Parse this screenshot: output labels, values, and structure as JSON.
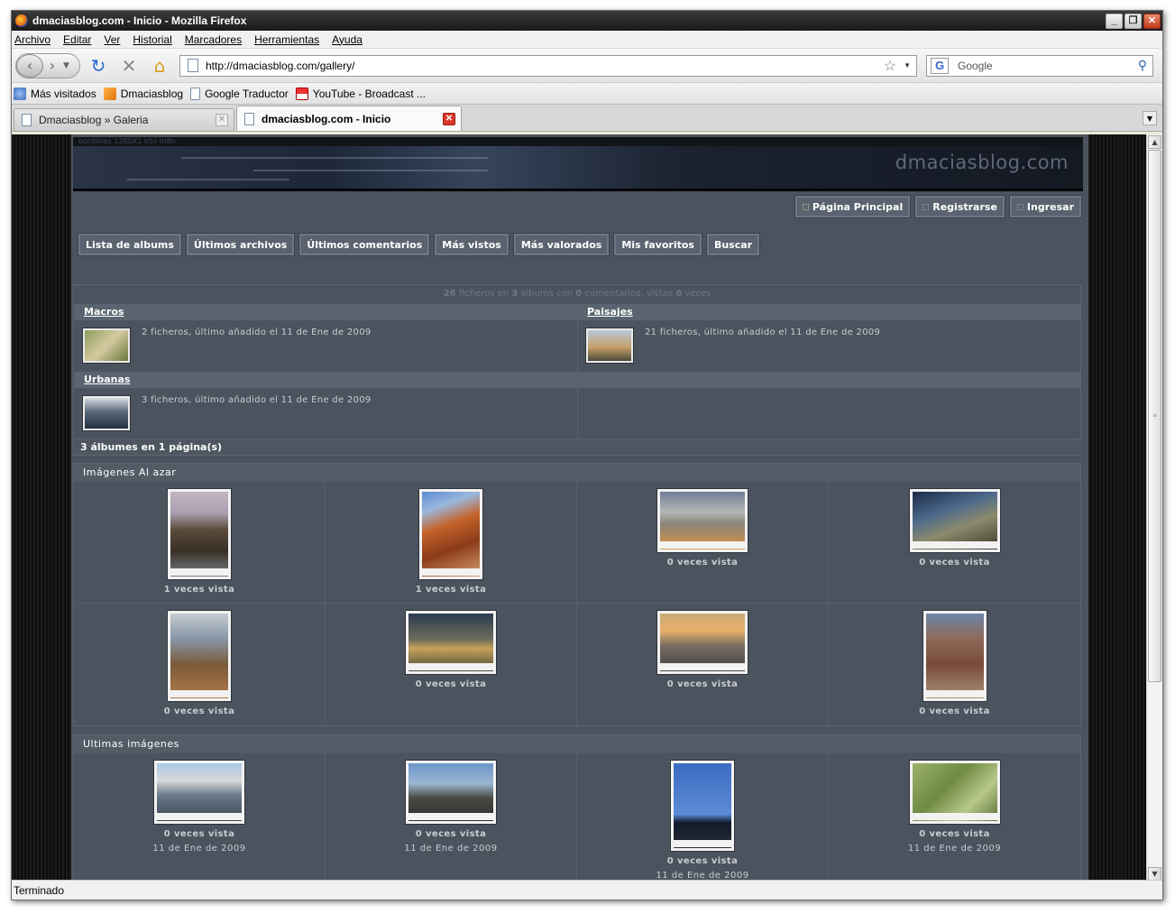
{
  "window": {
    "title": "dmaciasblog.com - Inicio - Mozilla Firefox"
  },
  "menubar": [
    "Archivo",
    "Editar",
    "Ver",
    "Historial",
    "Marcadores",
    "Herramientas",
    "Ayuda"
  ],
  "navbar": {
    "url": "http://dmaciasblog.com/gallery/",
    "search_placeholder": "Google"
  },
  "bookmarks": [
    "Más visitados",
    "Dmaciasblog",
    "Google Traductor",
    "YouTube - Broadcast ..."
  ],
  "tabs": [
    {
      "label": "Dmaciasblog » Galeria",
      "active": false
    },
    {
      "label": "dmaciasblog.com - Inicio",
      "active": true
    }
  ],
  "site": {
    "header_small": "bordlines 1280X1 b5s m8n",
    "name": "dmaciasblog.com",
    "top_menu": [
      "Página Principal",
      "Registrarse",
      "Ingresar"
    ],
    "sub_menu": [
      "Lista de albums",
      "Últimos archivos",
      "Últimos comentarios",
      "Más vistos",
      "Más valorados",
      "Mis favoritos",
      "Buscar"
    ],
    "stats": {
      "files": "26",
      "t1": "ficheros en",
      "albums": "3",
      "t2": "albums con",
      "comments": "0",
      "t3": "comentarios, vistas",
      "views": "6",
      "t4": "veces"
    },
    "albums": [
      {
        "name": "Macros",
        "info": "2 ficheros, último añadido el 11 de Ene de 2009"
      },
      {
        "name": "Paisajes",
        "info": "21 ficheros, último añadido el 11 de Ene de 2009"
      },
      {
        "name": "Urbanas",
        "info": "3 ficheros, último añadido el 11 de Ene de 2009"
      }
    ],
    "albums_count": "3 álbumes en 1 página(s)",
    "random": {
      "title": "Imágenes Al azar",
      "items": [
        {
          "caption": "1 veces vista"
        },
        {
          "caption": "1 veces vista"
        },
        {
          "caption": "0 veces vista"
        },
        {
          "caption": "0 veces vista"
        },
        {
          "caption": "0 veces vista"
        },
        {
          "caption": "0 veces vista"
        },
        {
          "caption": "0 veces vista"
        },
        {
          "caption": "0 veces vista"
        }
      ]
    },
    "latest": {
      "title": "Ultimas imágenes",
      "items": [
        {
          "caption": "0 veces vista",
          "date": "11 de Ene de 2009"
        },
        {
          "caption": "0 veces vista",
          "date": "11 de Ene de 2009"
        },
        {
          "caption": "0 veces vista",
          "date": "11 de Ene de 2009"
        },
        {
          "caption": "0 veces vista",
          "date": "11 de Ene de 2009"
        }
      ]
    }
  },
  "status": "Terminado"
}
